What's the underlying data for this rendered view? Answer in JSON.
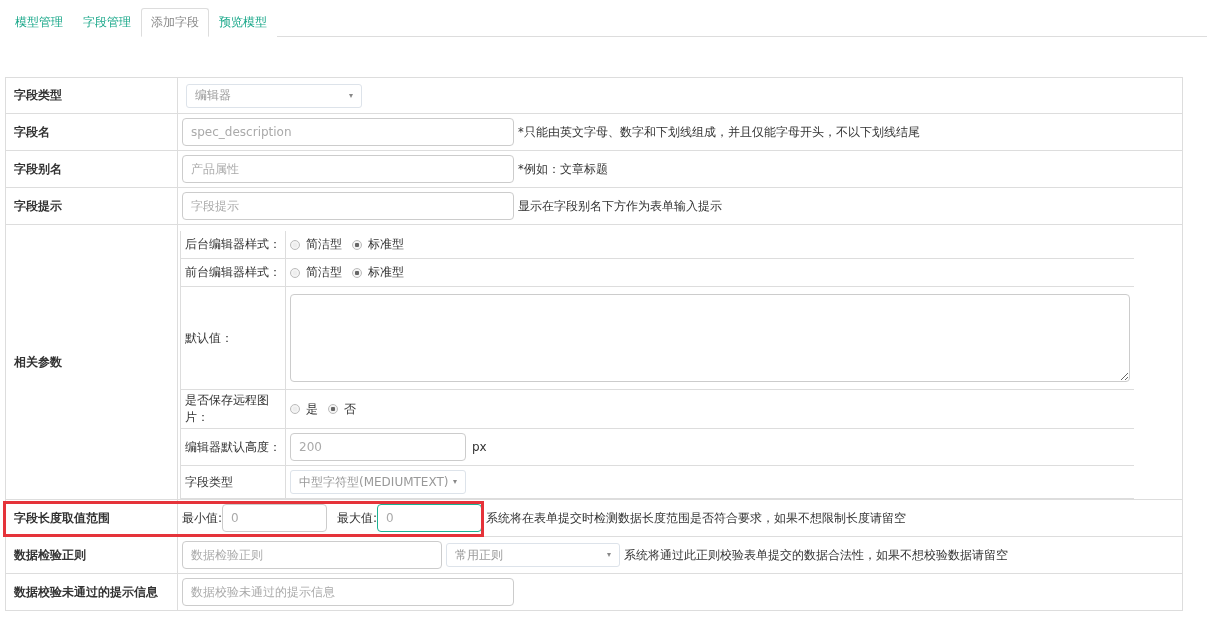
{
  "tabs": [
    {
      "label": "模型管理",
      "selected": false
    },
    {
      "label": "字段管理",
      "selected": false
    },
    {
      "label": "添加字段",
      "selected": true
    },
    {
      "label": "预览模型",
      "selected": false
    }
  ],
  "rows": [
    {
      "kind": "select",
      "label": "字段类型",
      "value": "编辑器"
    },
    {
      "kind": "input",
      "label": "字段名",
      "placeholder": "spec_description",
      "note": "*只能由英文字母、数字和下划线组成，并且仅能字母开头，不以下划线结尾"
    },
    {
      "kind": "input",
      "label": "字段别名",
      "placeholder": "产品属性",
      "note": "*例如：文章标题"
    },
    {
      "kind": "input",
      "label": "字段提示",
      "placeholder": "字段提示",
      "note": "显示在字段别名下方作为表单输入提示"
    },
    {
      "kind": "params",
      "label": "相关参数",
      "params": [
        {
          "kind": "radio",
          "label": "后台编辑器样式：",
          "options": [
            {
              "label": "简洁型",
              "selected": false
            },
            {
              "label": "标准型",
              "selected": true
            }
          ]
        },
        {
          "kind": "radio",
          "label": "前台编辑器样式：",
          "options": [
            {
              "label": "简洁型",
              "selected": false
            },
            {
              "label": "标准型",
              "selected": true
            }
          ]
        },
        {
          "kind": "textarea",
          "label": "默认值："
        },
        {
          "kind": "radio",
          "label": "是否保存远程图片：",
          "options": [
            {
              "label": "是",
              "selected": false
            },
            {
              "label": "否",
              "selected": true
            }
          ]
        },
        {
          "kind": "input",
          "label": "编辑器默认高度：",
          "placeholder": "200",
          "unit": "px"
        },
        {
          "kind": "select",
          "label": "字段类型",
          "value": "中型字符型(MEDIUMTEXT)"
        }
      ]
    },
    {
      "kind": "range",
      "label": "字段长度取值范围",
      "highlighted": true,
      "min_label": "最小值:",
      "min_placeholder": "0",
      "max_label": "最大值:",
      "max_placeholder": "0",
      "max_focused": true,
      "note": "系统将在表单提交时检测数据长度范围是否符合要求，如果不想限制长度请留空"
    },
    {
      "kind": "regex",
      "label": "数据检验正则",
      "placeholder": "数据检验正则",
      "select": "常用正则",
      "note": "系统将通过此正则校验表单提交的数据合法性，如果不想校验数据请留空"
    },
    {
      "kind": "input",
      "label": "数据校验未通过的提示信息",
      "placeholder": "数据校验未通过的提示信息"
    }
  ]
}
